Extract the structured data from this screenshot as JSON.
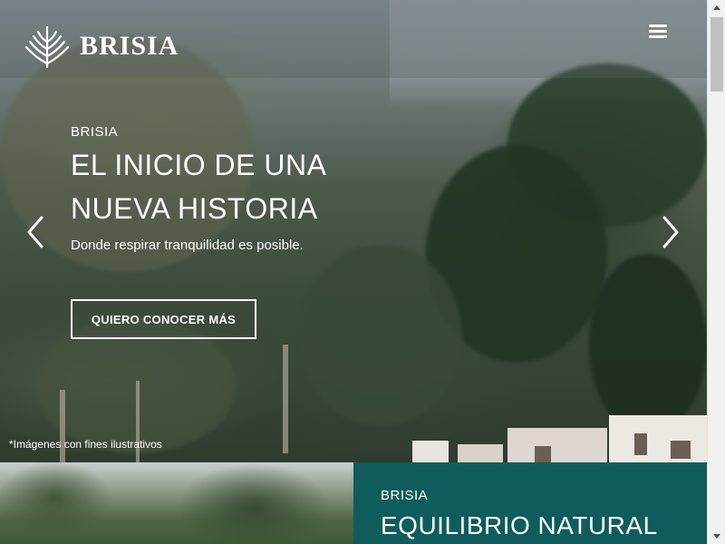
{
  "brand": {
    "name": "BRISIA",
    "logo_icon": "wheat-leaf-logo-icon"
  },
  "nav": {
    "menu_icon": "hamburger-menu-icon"
  },
  "hero": {
    "eyebrow": "BRISIA",
    "headline_line1": "EL INICIO DE UNA",
    "headline_line2": "NUEVA HISTORIA",
    "subtitle": "Donde respirar tranquilidad es posible.",
    "cta_label": "QUIERO CONOCER MÁS",
    "prev_icon": "chevron-left-icon",
    "next_icon": "chevron-right-icon",
    "disclaimer": "*Imágenes con fines ilustrativos"
  },
  "section": {
    "eyebrow": "BRISIA",
    "title": "EQUILIBRIO NATURAL"
  },
  "colors": {
    "panel_teal": "#0f5c5c",
    "text_white": "#ffffff"
  }
}
